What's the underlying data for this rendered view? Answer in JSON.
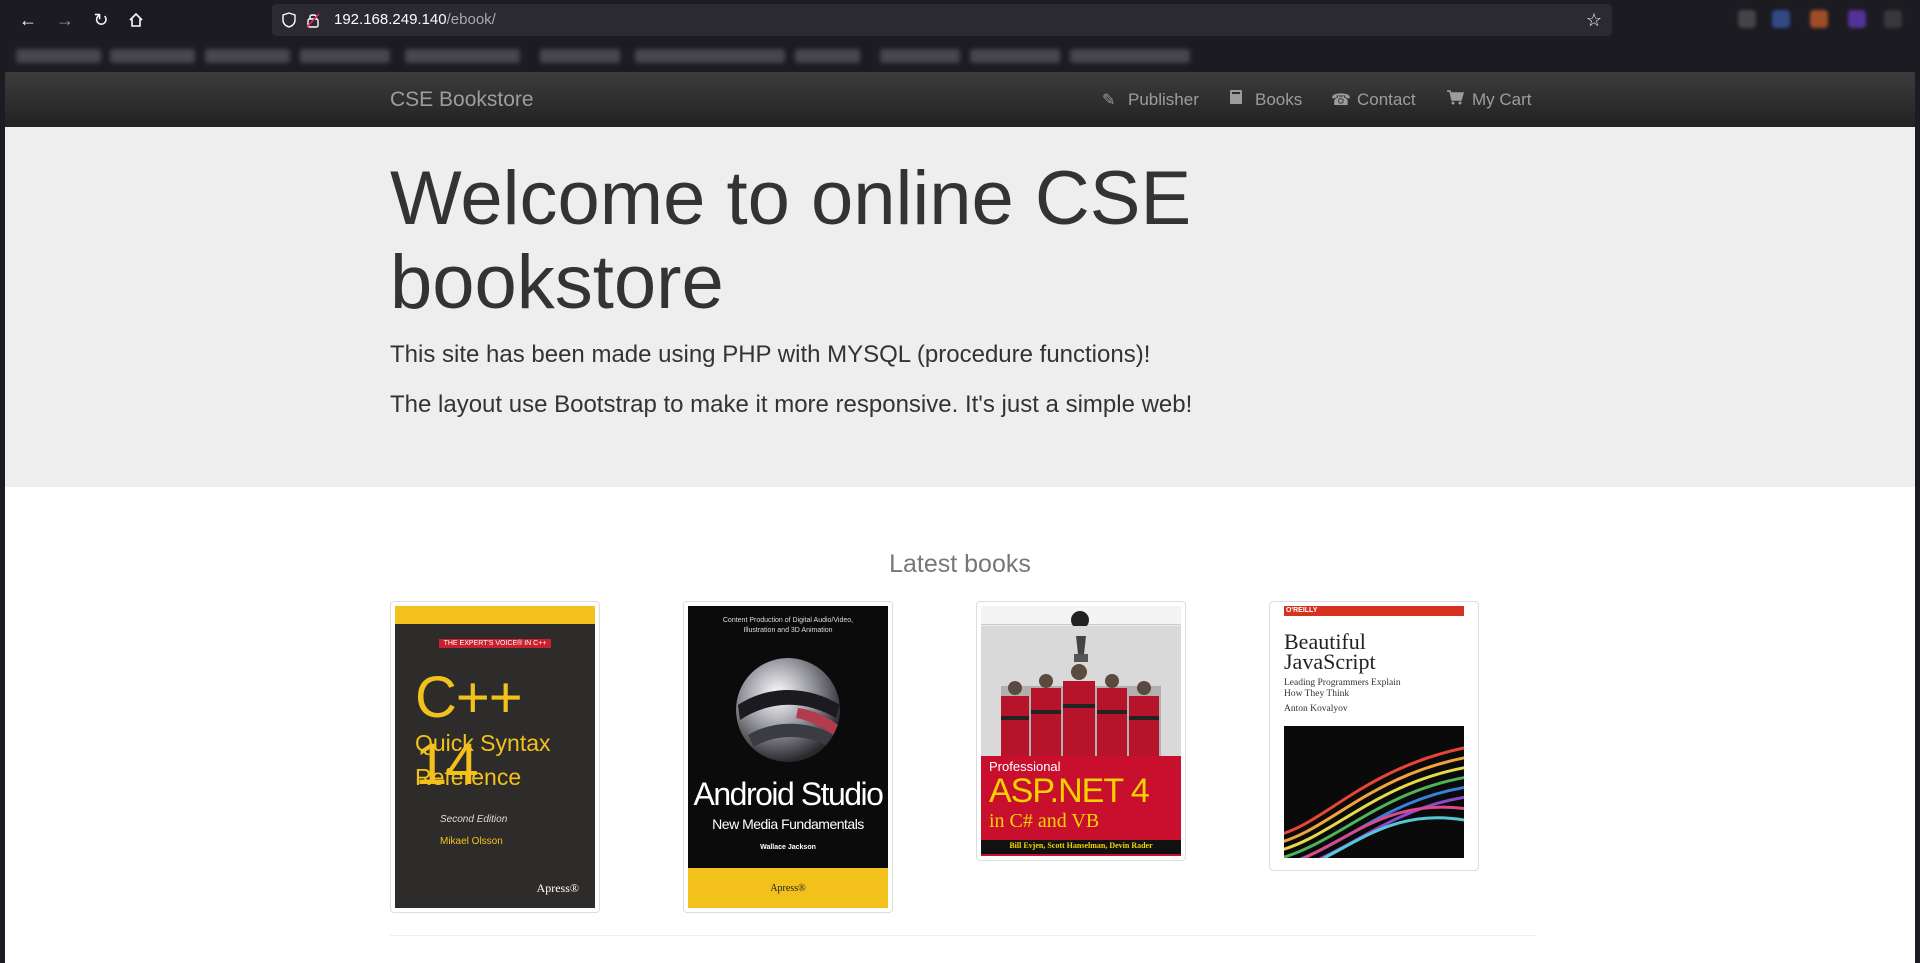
{
  "browser": {
    "url_host": "192.168.249.140",
    "url_path": "/ebook/"
  },
  "navbar": {
    "brand": "CSE Bookstore",
    "items": [
      {
        "label": "Publisher",
        "icon": "pencil-icon"
      },
      {
        "label": "Books",
        "icon": "book-icon"
      },
      {
        "label": "Contact",
        "icon": "phone-icon"
      },
      {
        "label": "My Cart",
        "icon": "cart-icon"
      }
    ]
  },
  "jumbotron": {
    "title": "Welcome to online CSE bookstore",
    "line1": "This site has been made using PHP with MYSQL (procedure functions)!",
    "line2": "The layout use Bootstrap to make it more responsive. It's just a simple web!"
  },
  "latest": {
    "heading": "Latest books",
    "books": [
      {
        "badge": "THE EXPERT'S VOICE® IN C++",
        "title_main": "C++ 14",
        "title_sub1": "Quick Syntax",
        "title_sub2": "Reference",
        "edition": "Second Edition",
        "author": "Mikael Olsson",
        "publisher": "Apress®",
        "colors": {
          "top": "#f3c11b",
          "bg": "#2e2c2a",
          "accent": "#f3c11b"
        }
      },
      {
        "tagline": "Content Production of Digital Audio/Video, Illustration and 3D Animation",
        "title_main": "Android Studio",
        "title_sub": "New Media Fundamentals",
        "author": "Wallace Jackson",
        "publisher": "Apress®",
        "colors": {
          "bg": "#0b0b0b",
          "bottom": "#f3c11b"
        }
      },
      {
        "series": "Professional",
        "title_main": "ASP.NET 4",
        "title_sub": "in C# and VB",
        "authors": "Bill Evjen, Scott Hanselman, Devin Rader",
        "colors": {
          "bg": "#c8102e",
          "accent": "#f5d300"
        }
      },
      {
        "publisher": "O'REILLY",
        "title_line1": "Beautiful",
        "title_line2": "JavaScript",
        "subtitle_line1": "Leading Programmers Explain",
        "subtitle_line2": "How They Think",
        "author": "Anton Kovalyov",
        "colors": {
          "bar": "#d5331f"
        }
      }
    ]
  }
}
